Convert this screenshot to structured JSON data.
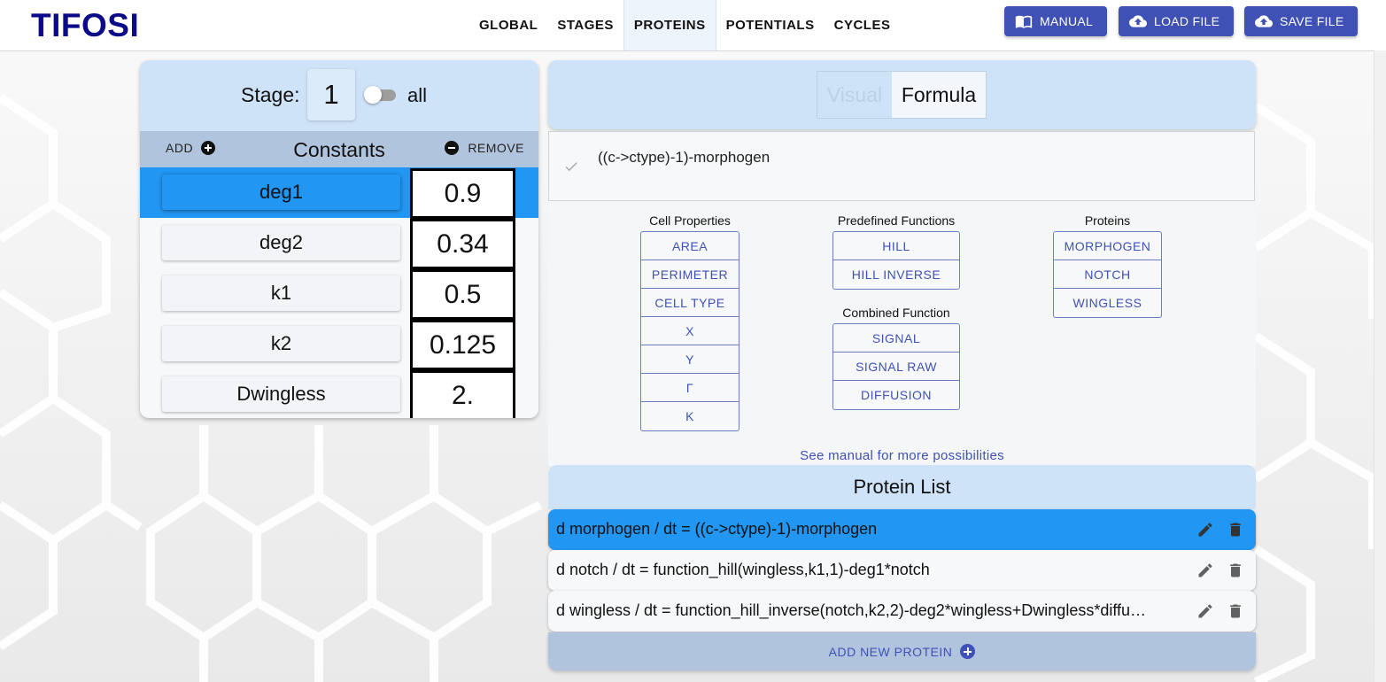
{
  "app": {
    "title": "TIFOSI"
  },
  "nav": {
    "tabs": [
      {
        "label": "GLOBAL",
        "active": false
      },
      {
        "label": "STAGES",
        "active": false
      },
      {
        "label": "PROTEINS",
        "active": true
      },
      {
        "label": "POTENTIALS",
        "active": false
      },
      {
        "label": "CYCLES",
        "active": false
      }
    ]
  },
  "header_buttons": {
    "manual": {
      "label": "MANUAL",
      "icon": "book-icon"
    },
    "load": {
      "label": "LOAD FILE",
      "icon": "cloud-upload-icon"
    },
    "save": {
      "label": "SAVE FILE",
      "icon": "cloud-upload-icon"
    }
  },
  "colors": {
    "accent": "#3f51b5",
    "selected": "#2196f3",
    "panel_header": "#cfe3f8",
    "bar": "#b0c4de",
    "logo": "#0b0b8a"
  },
  "stage": {
    "label": "Stage:",
    "value": "1",
    "toggle_label": "all",
    "toggle_on": false
  },
  "constants": {
    "add_label": "ADD",
    "title": "Constants",
    "remove_label": "REMOVE",
    "rows": [
      {
        "name": "deg1",
        "value": "0.9",
        "selected": true
      },
      {
        "name": "deg2",
        "value": "0.34",
        "selected": false
      },
      {
        "name": "k1",
        "value": "0.5",
        "selected": false
      },
      {
        "name": "k2",
        "value": "0.125",
        "selected": false
      },
      {
        "name": "Dwingless",
        "value": "2.",
        "selected": false
      }
    ]
  },
  "editor": {
    "mode_tabs": [
      {
        "label": "Visual",
        "active": false
      },
      {
        "label": "Formula",
        "active": true
      }
    ],
    "formula": "((c->ctype)-1)-morphogen",
    "groups": {
      "cell_properties": {
        "title": "Cell Properties",
        "buttons": [
          "AREA",
          "PERIMETER",
          "CELL TYPE",
          "X",
          "Y",
          "Γ",
          "K"
        ]
      },
      "predefined_functions": {
        "title": "Predefined Functions",
        "buttons": [
          "HILL",
          "HILL INVERSE"
        ]
      },
      "combined_function": {
        "title": "Combined Function",
        "buttons": [
          "SIGNAL",
          "SIGNAL RAW",
          "DIFFUSION"
        ]
      },
      "proteins": {
        "title": "Proteins",
        "buttons": [
          "MORPHOGEN",
          "NOTCH",
          "WINGLESS"
        ]
      }
    },
    "see_manual": "See manual for more possibilities"
  },
  "protein_list": {
    "title": "Protein List",
    "items": [
      {
        "text": "d morphogen / dt = ((c->ctype)-1)-morphogen",
        "selected": true
      },
      {
        "text": "d notch / dt = function_hill(wingless,k1,1)-deg1*notch",
        "selected": false
      },
      {
        "text": "d wingless / dt = function_hill_inverse(notch,k2,2)-deg2*wingless+Dwingless*diffu…",
        "selected": false
      }
    ],
    "add_label": "ADD NEW PROTEIN"
  }
}
